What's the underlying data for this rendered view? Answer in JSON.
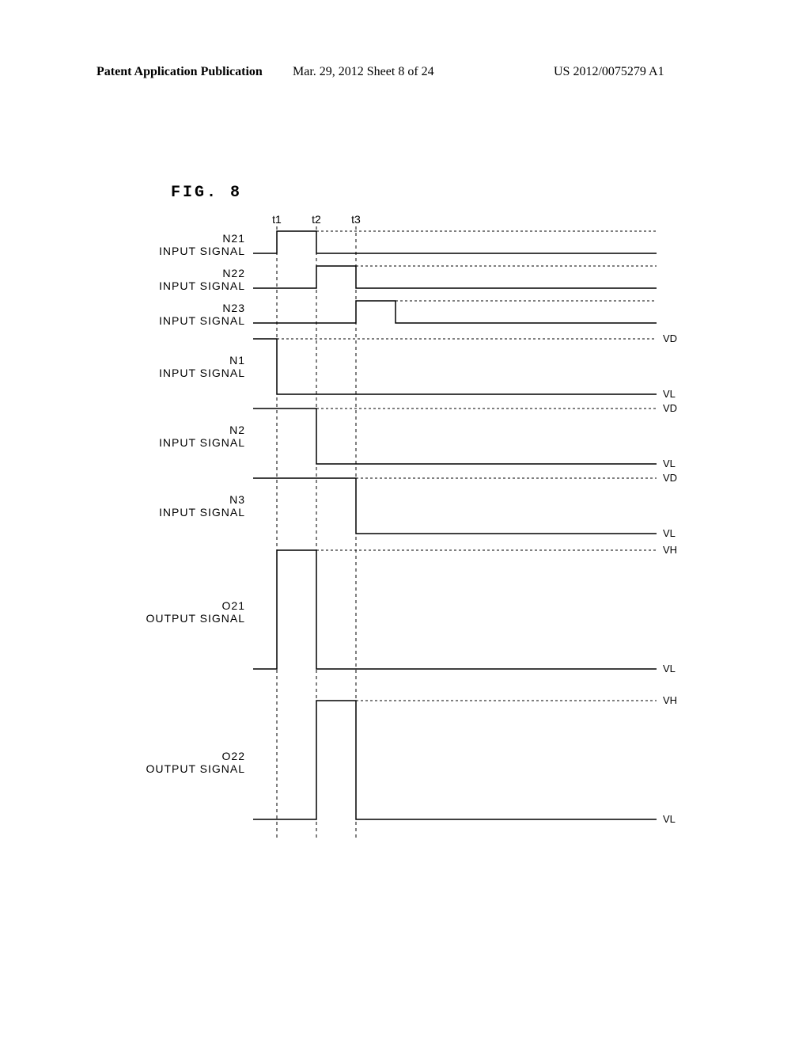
{
  "header": {
    "left": "Patent Application Publication",
    "center": "Mar. 29, 2012  Sheet 8 of 24",
    "right": "US 2012/0075279 A1"
  },
  "figure_title": "FIG. 8",
  "time_labels": [
    "t1",
    "t2",
    "t3"
  ],
  "signals": [
    {
      "name": "N21",
      "sub": "INPUT SIGNAL"
    },
    {
      "name": "N22",
      "sub": "INPUT SIGNAL"
    },
    {
      "name": "N23",
      "sub": "INPUT SIGNAL"
    },
    {
      "name": "N1",
      "sub": "INPUT SIGNAL"
    },
    {
      "name": "N2",
      "sub": "INPUT SIGNAL"
    },
    {
      "name": "N3",
      "sub": "INPUT SIGNAL"
    },
    {
      "name": "O21",
      "sub": "OUTPUT SIGNAL"
    },
    {
      "name": "O22",
      "sub": "OUTPUT SIGNAL"
    }
  ],
  "levels": {
    "vd": "VD",
    "vl": "VL",
    "vh": "VH"
  },
  "chart_data": {
    "type": "timing-diagram",
    "time_points": [
      "t1",
      "t2",
      "t3"
    ],
    "traces": [
      {
        "name": "N21 INPUT SIGNAL",
        "type": "pulse",
        "high_at": "t1",
        "low_at": "t2",
        "levels": null
      },
      {
        "name": "N22 INPUT SIGNAL",
        "type": "pulse",
        "high_at": "t2",
        "low_at": "t3",
        "levels": null
      },
      {
        "name": "N23 INPUT SIGNAL",
        "type": "pulse",
        "high_at": "t3",
        "low_at": "after_t3",
        "levels": null
      },
      {
        "name": "N1 INPUT SIGNAL",
        "type": "step_down",
        "at": "t1",
        "levels": {
          "high": "VD",
          "low": "VL"
        }
      },
      {
        "name": "N2 INPUT SIGNAL",
        "type": "step_down",
        "at": "t2",
        "levels": {
          "high": "VD",
          "low": "VL"
        }
      },
      {
        "name": "N3 INPUT SIGNAL",
        "type": "step_down",
        "at": "t3",
        "levels": {
          "high": "VD",
          "low": "VL"
        }
      },
      {
        "name": "O21 OUTPUT SIGNAL",
        "type": "pulse",
        "high_at": "t1",
        "low_at": "t2",
        "levels": {
          "high": "VH",
          "low": "VL"
        }
      },
      {
        "name": "O22 OUTPUT SIGNAL",
        "type": "pulse",
        "high_at": "t2",
        "low_at": "t3",
        "levels": {
          "high": "VH",
          "low": "VL"
        }
      }
    ]
  }
}
